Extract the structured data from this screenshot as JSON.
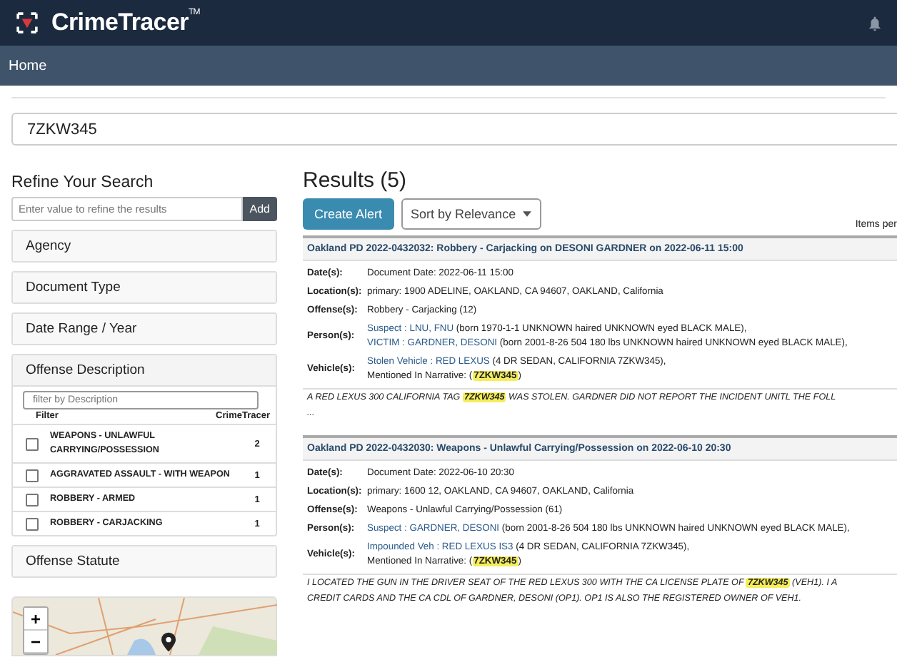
{
  "app": {
    "title": "CrimeTracer",
    "trademark": "TM"
  },
  "nav": {
    "items": [
      {
        "label": "Home",
        "selected": true
      }
    ]
  },
  "search": {
    "value": "7ZKW345"
  },
  "refine": {
    "title": "Refine Your Search",
    "placeholder": "Enter value to refine the results",
    "add_button": "Add",
    "sections": [
      {
        "label": "Agency",
        "expanded": false
      },
      {
        "label": "Document Type",
        "expanded": false
      },
      {
        "label": "Date Range / Year",
        "expanded": false
      },
      {
        "label": "Offense Description",
        "expanded": true
      },
      {
        "label": "Offense Statute",
        "expanded": false
      }
    ],
    "offense_filter": {
      "placeholder": "filter by Description",
      "columns": [
        "Filter",
        "CrimeTracer"
      ],
      "rows": [
        {
          "label": "WEAPONS - UNLAWFUL CARRYING/POSSESSION",
          "count": "2",
          "checked": false
        },
        {
          "label": "AGGRAVATED ASSAULT - WITH WEAPON",
          "count": "1",
          "checked": false
        },
        {
          "label": "ROBBERY - ARMED",
          "count": "1",
          "checked": false
        },
        {
          "label": "ROBBERY - CARJACKING",
          "count": "1",
          "checked": false
        }
      ]
    },
    "map": {
      "zoom_in": "+",
      "zoom_out": "−"
    }
  },
  "results": {
    "title": "Results (5)",
    "create_alert": "Create Alert",
    "sort": "Sort by Relevance",
    "items_per": "Items per",
    "items": [
      {
        "heading": "Oakland PD 2022-0432032: Robbery - Carjacking on DESONI GARDNER on 2022-06-11 15:00",
        "fields": [
          {
            "label": "Date(s):",
            "lines": [
              [
                {
                  "kind": "plain",
                  "text": "Document Date: 2022-06-11 15:00"
                }
              ]
            ]
          },
          {
            "label": "Location(s):",
            "lines": [
              [
                {
                  "kind": "plain",
                  "text": "primary: 1900 ADELINE, OAKLAND, CA 94607, OAKLAND, California"
                }
              ]
            ]
          },
          {
            "label": "Offense(s):",
            "lines": [
              [
                {
                  "kind": "plain",
                  "text": "Robbery - Carjacking (12)"
                }
              ]
            ]
          },
          {
            "label": "Person(s):",
            "lines": [
              [
                {
                  "kind": "link",
                  "text": "Suspect : LNU, FNU"
                },
                {
                  "kind": "plain",
                  "text": " (born 1970-1-1 UNKNOWN haired UNKNOWN eyed BLACK MALE),"
                }
              ],
              [
                {
                  "kind": "link",
                  "text": "VICTIM : GARDNER, DESONI"
                },
                {
                  "kind": "plain",
                  "text": " (born 2001-8-26 504 180 lbs UNKNOWN haired UNKNOWN eyed BLACK MALE),"
                }
              ]
            ]
          },
          {
            "label": "Vehicle(s):",
            "lines": [
              [
                {
                  "kind": "link",
                  "text": "Stolen Vehicle : RED LEXUS"
                },
                {
                  "kind": "plain",
                  "text": " (4 DR SEDAN, CALIFORNIA 7ZKW345),"
                }
              ],
              [
                {
                  "kind": "plain",
                  "text": "Mentioned In Narrative: ("
                },
                {
                  "kind": "highlight",
                  "text": "7ZKW345"
                },
                {
                  "kind": "plain",
                  "text": ")"
                }
              ]
            ]
          }
        ],
        "narrative": [
          [
            {
              "kind": "plain",
              "text": "A RED LEXUS 300 CALIFORNIA TAG "
            },
            {
              "kind": "highlight",
              "text": "7ZKW345"
            },
            {
              "kind": "plain",
              "text": " WAS STOLEN. GARDNER DID NOT REPORT THE INCIDENT UNITL THE FOLL"
            }
          ],
          [
            {
              "kind": "plain",
              "text": "..."
            }
          ]
        ]
      },
      {
        "heading": "Oakland PD 2022-0432030: Weapons - Unlawful Carrying/Possession on 2022-06-10 20:30",
        "fields": [
          {
            "label": "Date(s):",
            "lines": [
              [
                {
                  "kind": "plain",
                  "text": "Document Date: 2022-06-10 20:30"
                }
              ]
            ]
          },
          {
            "label": "Location(s):",
            "lines": [
              [
                {
                  "kind": "plain",
                  "text": "primary: 1600 12, OAKLAND, CA 94607, OAKLAND, California"
                }
              ]
            ]
          },
          {
            "label": "Offense(s):",
            "lines": [
              [
                {
                  "kind": "plain",
                  "text": "Weapons - Unlawful Carrying/Possession (61)"
                }
              ]
            ]
          },
          {
            "label": "Person(s):",
            "lines": [
              [
                {
                  "kind": "link",
                  "text": "Suspect : GARDNER, DESONI"
                },
                {
                  "kind": "plain",
                  "text": " (born 2001-8-26 504 180 lbs UNKNOWN haired UNKNOWN eyed BLACK MALE),"
                }
              ]
            ]
          },
          {
            "label": "Vehicle(s):",
            "lines": [
              [
                {
                  "kind": "link",
                  "text": "Impounded Veh : RED LEXUS IS3"
                },
                {
                  "kind": "plain",
                  "text": " (4 DR SEDAN, CALIFORNIA 7ZKW345),"
                }
              ],
              [
                {
                  "kind": "plain",
                  "text": "Mentioned In Narrative: ("
                },
                {
                  "kind": "highlight",
                  "text": "7ZKW345"
                },
                {
                  "kind": "plain",
                  "text": ")"
                }
              ]
            ]
          }
        ],
        "narrative": [
          [
            {
              "kind": "plain",
              "text": "I LOCATED THE GUN IN THE DRIVER SEAT OF THE RED LEXUS 300 WITH THE CA LICENSE PLATE OF "
            },
            {
              "kind": "highlight",
              "text": "7ZKW345"
            },
            {
              "kind": "plain",
              "text": " (VEH1). I A"
            }
          ],
          [
            {
              "kind": "plain",
              "text": "CREDIT CARDS AND THE CA CDL OF GARDNER, DESONI (OP1). OP1 IS ALSO THE REGISTERED OWNER OF VEH1."
            }
          ]
        ]
      }
    ]
  }
}
